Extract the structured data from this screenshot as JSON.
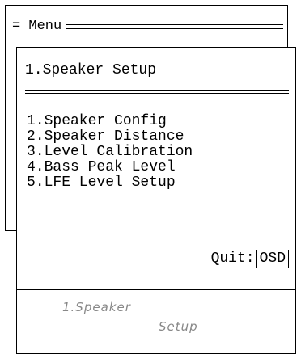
{
  "menu": {
    "title": "= Menu"
  },
  "submenu": {
    "title": "1.Speaker Setup",
    "items": [
      {
        "label": "1.Speaker Config"
      },
      {
        "label": "2.Speaker Distance"
      },
      {
        "label": "3.Level Calibration"
      },
      {
        "label": "4.Bass Peak Level"
      },
      {
        "label": "5.LFE Level Setup"
      }
    ],
    "quit_label": "Quit:",
    "quit_key": "OSD"
  },
  "osd_display": {
    "line1": "1.Speaker",
    "line2": "Setup"
  }
}
